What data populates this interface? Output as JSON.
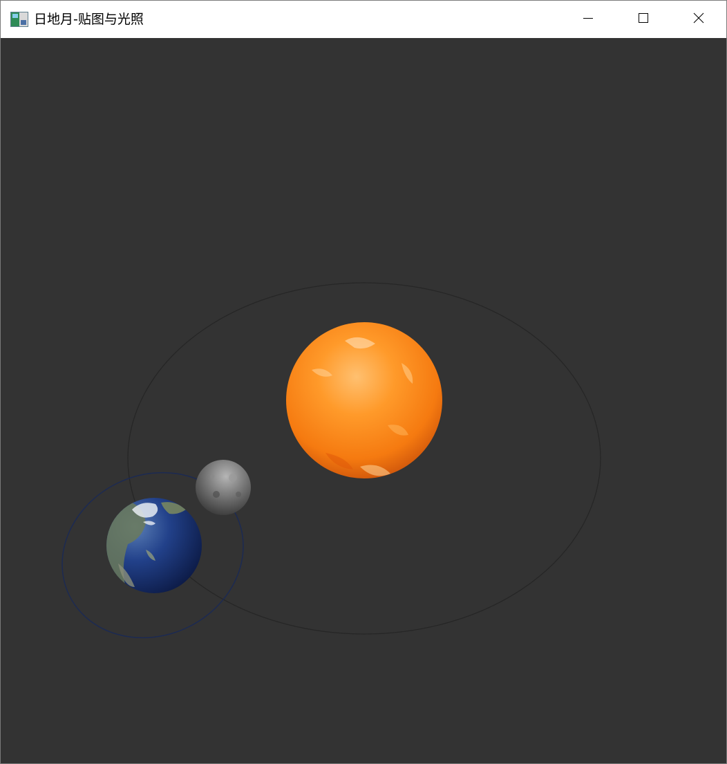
{
  "window": {
    "title": "日地月-贴图与光照",
    "icon": "opengl-app-icon",
    "buttons": [
      "minimize-icon",
      "maximize-icon",
      "close-icon"
    ]
  },
  "scene": {
    "background_color": "#333333",
    "sun_color": "#ff8c1a",
    "earth_color": "#1f3f8f",
    "moon_color": "#6e6e6e",
    "earth_orbit_color": "#262626",
    "moon_orbit_color": "#1c2a52"
  }
}
